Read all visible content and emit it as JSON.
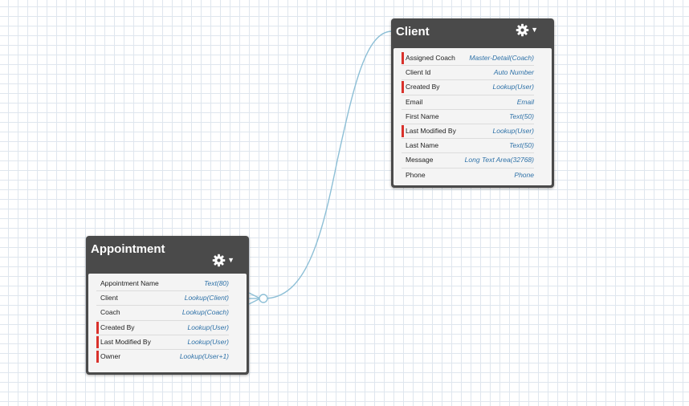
{
  "colors": {
    "connector": "#8dbfd6",
    "header": "#4a4a4a",
    "required_marker": "#d9312b",
    "field_type_text": "#2f72a8"
  },
  "entities": {
    "client": {
      "title": "Client",
      "menu_icon": "gear-icon",
      "fields": [
        {
          "name": "Assigned Coach",
          "type": "Master-Detail(Coach)",
          "required": true
        },
        {
          "name": "Client Id",
          "type": "Auto Number",
          "required": false
        },
        {
          "name": "Created By",
          "type": "Lookup(User)",
          "required": true
        },
        {
          "name": "Email",
          "type": "Email",
          "required": false
        },
        {
          "name": "First Name",
          "type": "Text(50)",
          "required": false
        },
        {
          "name": "Last Modified By",
          "type": "Lookup(User)",
          "required": true
        },
        {
          "name": "Last Name",
          "type": "Text(50)",
          "required": false
        },
        {
          "name": "Message",
          "type": "Long Text Area(32768)",
          "required": false
        },
        {
          "name": "Phone",
          "type": "Phone",
          "required": false
        }
      ]
    },
    "appointment": {
      "title": "Appointment",
      "menu_icon": "gear-icon",
      "fields": [
        {
          "name": "Appointment Name",
          "type": "Text(80)",
          "required": false
        },
        {
          "name": "Client",
          "type": "Lookup(Client)",
          "required": false
        },
        {
          "name": "Coach",
          "type": "Lookup(Coach)",
          "required": false
        },
        {
          "name": "Created By",
          "type": "Lookup(User)",
          "required": true
        },
        {
          "name": "Last Modified By",
          "type": "Lookup(User)",
          "required": true
        },
        {
          "name": "Owner",
          "type": "Lookup(User+1)",
          "required": true
        }
      ]
    }
  },
  "relationship": {
    "from": "Appointment",
    "to": "Client",
    "notation": "crow-foot-optional-many"
  }
}
